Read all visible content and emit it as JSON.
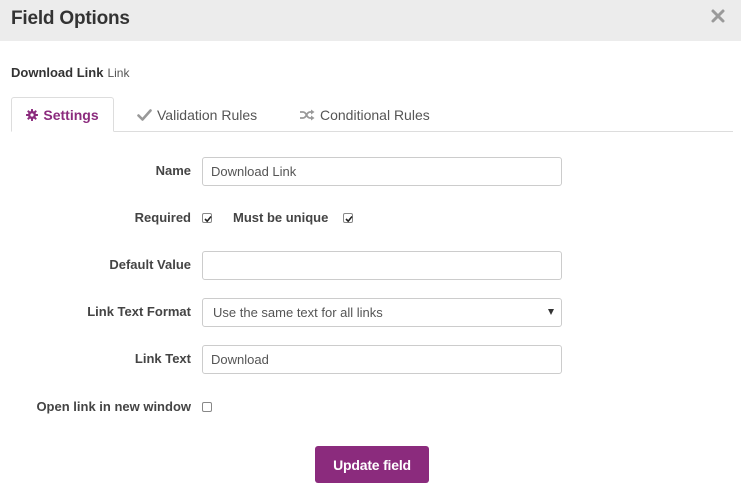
{
  "header": {
    "title": "Field Options"
  },
  "field": {
    "name": "Download Link",
    "type": "Link"
  },
  "tabs": [
    {
      "label": "Settings",
      "icon": "gear-icon",
      "active": true
    },
    {
      "label": "Validation Rules",
      "icon": "checkmark-icon",
      "active": false
    },
    {
      "label": "Conditional Rules",
      "icon": "shuffle-icon",
      "active": false
    }
  ],
  "form": {
    "name": {
      "label": "Name",
      "value": "Download Link"
    },
    "required": {
      "label": "Required",
      "checked": true
    },
    "unique": {
      "label": "Must be unique",
      "checked": true
    },
    "default_value": {
      "label": "Default Value",
      "value": ""
    },
    "link_text_format": {
      "label": "Link Text Format",
      "value": "Use the same text for all links"
    },
    "link_text": {
      "label": "Link Text",
      "value": "Download"
    },
    "new_window": {
      "label": "Open link in new window",
      "checked": false
    }
  },
  "actions": {
    "update_label": "Update field"
  },
  "colors": {
    "accent": "#8b2b7d",
    "header_bg": "#ececec"
  }
}
